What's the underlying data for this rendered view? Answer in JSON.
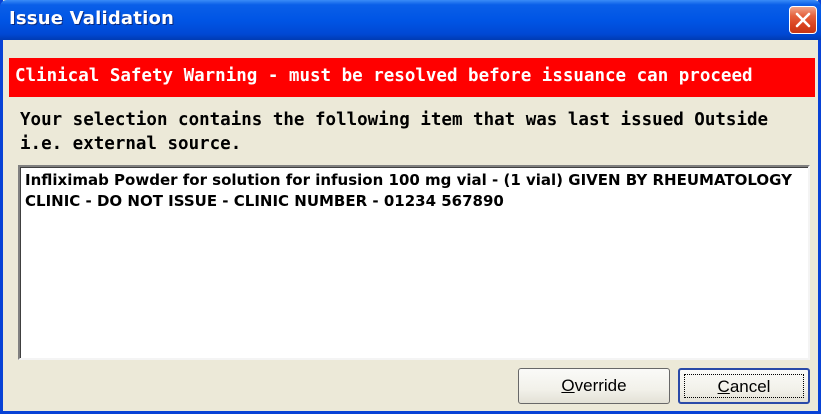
{
  "window": {
    "title": "Issue Validation"
  },
  "warning": {
    "text": "Clinical Safety Warning - must be resolved before issuance can proceed",
    "background_color": "#ff0000"
  },
  "message": {
    "text": "Your selection contains the following item that was last issued Outside i.e. external source."
  },
  "item_box": {
    "text": "Infliximab  Powder for solution for infusion  100 mg vial - (1 vial) GIVEN BY RHEUMATOLOGY CLINIC - DO NOT ISSUE - CLINIC NUMBER - 01234 567890"
  },
  "buttons": {
    "override": {
      "access_key": "O",
      "rest": "verride"
    },
    "cancel": {
      "access_key": "C",
      "rest": "ancel"
    }
  },
  "icons": {
    "close": "close-icon"
  },
  "colors": {
    "titlebar": "#0055e5",
    "dialog_face": "#ece9d8"
  }
}
